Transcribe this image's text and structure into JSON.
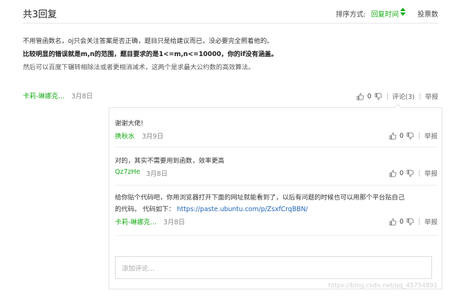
{
  "header": {
    "title": "共3回复",
    "sort_label": "排序方式:",
    "sort_value": "回复时间",
    "votes_label": "投票数"
  },
  "answer": {
    "lines": [
      "不用管函数名，oj只会关注答案是否正确，题目只是给建议而已，没必要完全照着他的。",
      "比较明显的错误就是m,n的范围，题目要求的是1<=m,n<=10000，你的if没有涵盖。",
      "然后可以百度下辗转相除法或者更相消减术，这两个是求最大公约数的高效算法。"
    ],
    "author": "卡莉-琳娜克...",
    "date": "3月8日",
    "votes": "0",
    "comments_label": "评论(3)",
    "report_label": "举报"
  },
  "comments": [
    {
      "text": "谢谢大佬!",
      "author": "携秋水",
      "date": "3月9日",
      "votes": "0",
      "report_label": "举报"
    },
    {
      "text": "对的，其实不需要用到函数，效率更高",
      "author": "Qz7zHe",
      "date": "3月8日",
      "votes": "0",
      "report_label": "举报"
    },
    {
      "text_line1": "给你贴个代码吧，你用浏览器打开下面的网址就能看到了，以后有问题的时候也可以用那个平台贴自己",
      "text_line2_prefix": "的代码。 代码如下：",
      "url": "https://paste.ubuntu.com/p/ZsxfCrqBBN/",
      "author": "卡莉-琳娜克...",
      "date": "3月8日",
      "votes": "0",
      "report_label": "举报"
    }
  ],
  "comment_input": {
    "placeholder": "添加评论..."
  },
  "watermark": "https://blog.csdn.net/qq_45754891",
  "colors": {
    "accent_green": "#1aad19",
    "link_blue": "#2266bb"
  }
}
